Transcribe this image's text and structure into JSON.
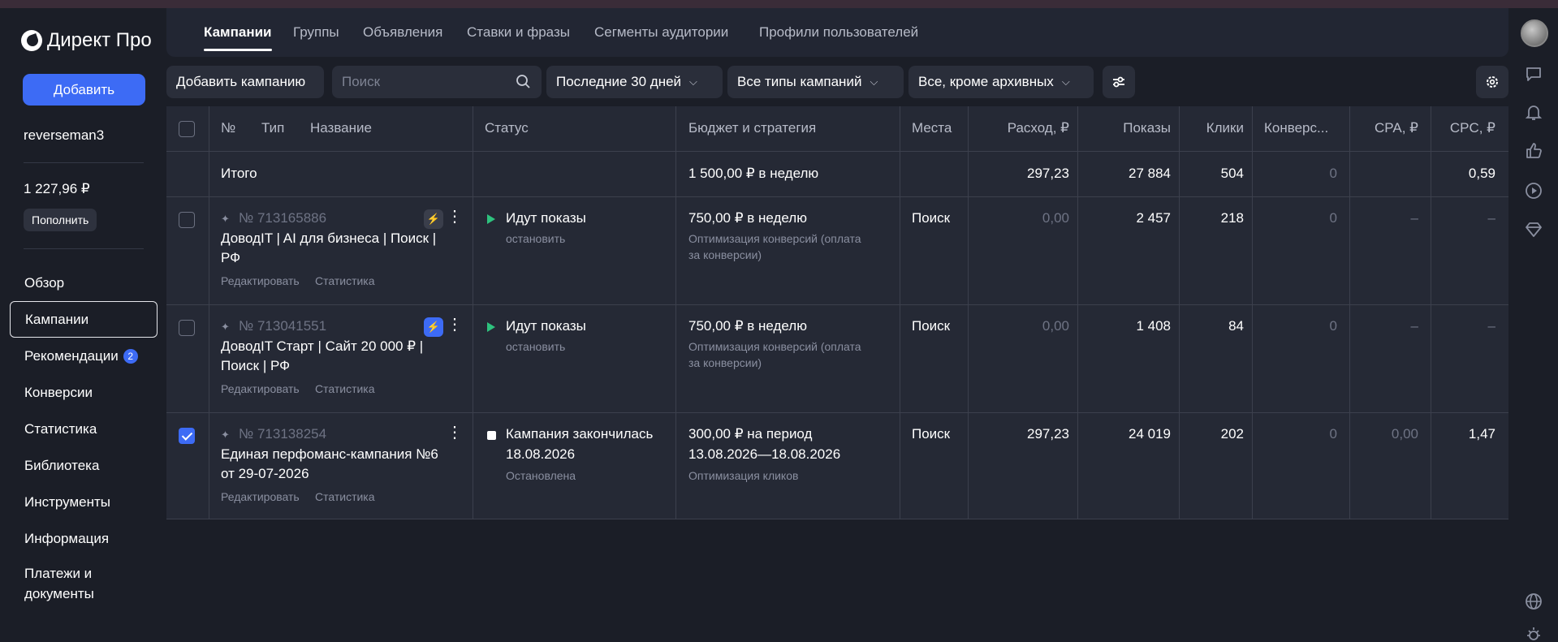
{
  "sidebar": {
    "logo": "Директ Про",
    "add_button": "Добавить",
    "username": "reverseman3",
    "balance": "1 227,96 ₽",
    "topup": "Пополнить",
    "items": [
      {
        "label": "Обзор"
      },
      {
        "label": "Кампании",
        "active": true
      },
      {
        "label": "Рекомендации",
        "badge": "2"
      },
      {
        "label": "Конверсии"
      },
      {
        "label": "Статистика"
      },
      {
        "label": "Библиотека"
      },
      {
        "label": "Инструменты"
      },
      {
        "label": "Информация"
      },
      {
        "label": "Платежи и документы"
      }
    ]
  },
  "tabs": [
    "Кампании",
    "Группы",
    "Объявления",
    "Ставки и фразы",
    "Сегменты аудитории",
    "Профили пользователей"
  ],
  "toolbar": {
    "add_campaign": "Добавить кампанию",
    "search_placeholder": "Поиск",
    "period": "Последние 30 дней",
    "types": "Все типы кампаний",
    "archive": "Все, кроме архивных"
  },
  "table": {
    "headers": {
      "num": "№",
      "type": "Тип",
      "name": "Название",
      "status": "Статус",
      "budget": "Бюджет и стратегия",
      "places": "Места",
      "spend": "Расход, ₽",
      "impressions": "Показы",
      "clicks": "Клики",
      "conversions": "Конверс...",
      "cpa": "CPA, ₽",
      "cpc": "CPC, ₽"
    },
    "total": {
      "label": "Итого",
      "budget": "1 500,00 ₽ в неделю",
      "spend": "297,23",
      "impressions": "27 884",
      "clicks": "504",
      "conversions": "0",
      "cpc": "0,59"
    },
    "rows": [
      {
        "id": "№ 713165886",
        "name_line1": "ДоводIT | AI для бизнеса | Поиск |",
        "name_line2": "РФ",
        "edit": "Редактировать",
        "stats": "Статистика",
        "status": "Идут показы",
        "status_action": "остановить",
        "budget": "750,00 ₽ в неделю",
        "strategy_line1": "Оптимизация конверсий (оплата",
        "strategy_line2": "за конверсии)",
        "places": "Поиск",
        "spend": "0,00",
        "impressions": "2 457",
        "clicks": "218",
        "conversions": "0",
        "cpa": "–",
        "cpc": "–",
        "checked": false
      },
      {
        "id": "№ 713041551",
        "name_line1": "ДоводIT Старт | Сайт 20 000 ₽ |",
        "name_line2": "Поиск | РФ",
        "edit": "Редактировать",
        "stats": "Статистика",
        "status": "Идут показы",
        "status_action": "остановить",
        "budget": "750,00 ₽ в неделю",
        "strategy_line1": "Оптимизация конверсий (оплата",
        "strategy_line2": "за конверсии)",
        "places": "Поиск",
        "spend": "0,00",
        "impressions": "1 408",
        "clicks": "84",
        "conversions": "0",
        "cpa": "–",
        "cpc": "–",
        "checked": false
      },
      {
        "id": "№ 713138254",
        "name_line1": "Единая перфоманс-кампания №6",
        "name_line2": "от 29-07-2026",
        "edit": "Редактировать",
        "stats": "Статистика",
        "status_line1": "Кампания закончилась",
        "status_line2": "18.08.2026",
        "status_action": "Остановлена",
        "budget_line1": "300,00 ₽ на период",
        "budget_line2": "13.08.2026—18.08.2026",
        "strategy_line1": "Оптимизация кликов",
        "places": "Поиск",
        "spend": "297,23",
        "impressions": "24 019",
        "clicks": "202",
        "conversions": "0",
        "cpa": "0,00",
        "cpc": "1,47",
        "checked": true
      }
    ]
  }
}
